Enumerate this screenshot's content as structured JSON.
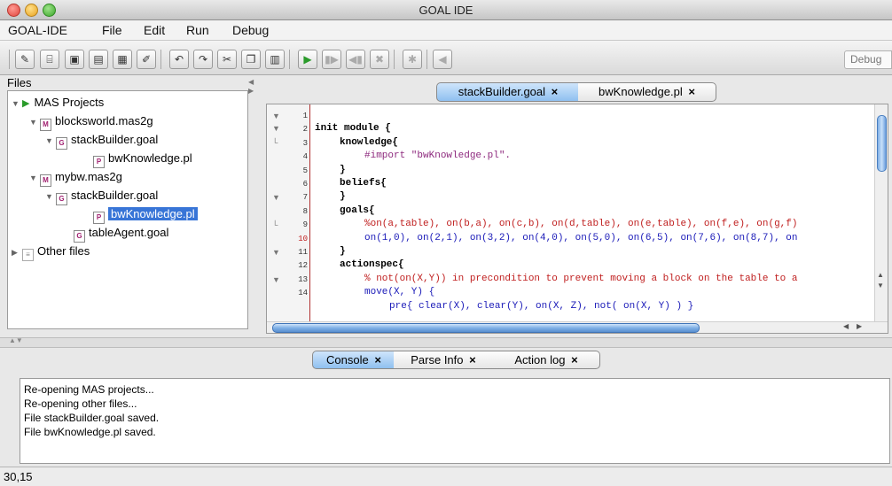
{
  "window": {
    "title": "GOAL IDE"
  },
  "menubar": {
    "items": [
      "GOAL-IDE",
      "File",
      "Edit",
      "Run",
      "Debug"
    ]
  },
  "toolbar": {
    "debug_label": "Debug"
  },
  "files": {
    "header": "Files",
    "tree": [
      {
        "label": "MAS Projects"
      },
      {
        "label": "blocksworld.mas2g"
      },
      {
        "label": "stackBuilder.goal"
      },
      {
        "label": "bwKnowledge.pl"
      },
      {
        "label": "mybw.mas2g"
      },
      {
        "label": "stackBuilder.goal"
      },
      {
        "label": "bwKnowledge.pl"
      },
      {
        "label": "tableAgent.goal"
      },
      {
        "label": "Other files"
      }
    ]
  },
  "editor": {
    "tabs": [
      {
        "label": "stackBuilder.goal",
        "close": "×"
      },
      {
        "label": "bwKnowledge.pl",
        "close": "×"
      }
    ],
    "line_numbers": [
      "1",
      "2",
      "3",
      "4",
      "5",
      "6",
      "7",
      "8",
      "9",
      "10",
      "11",
      "12",
      "13",
      "14"
    ],
    "lines": [
      "init module {",
      "knowledge{",
      "#import \"bwKnowledge.pl\".",
      "}",
      "beliefs{",
      "}",
      "goals{",
      "%on(a,table), on(b,a), on(c,b), on(d,table), on(e,table), on(f,e), on(g,f)",
      "on(1,0), on(2,1), on(3,2), on(4,0), on(5,0), on(6,5), on(7,6), on(8,7), on",
      "}",
      "actionspec{",
      "% not(on(X,Y)) in precondition to prevent moving a block on the table to a",
      "move(X, Y) {",
      "pre{ clear(X), clear(Y), on(X, Z), not( on(X, Y) ) }"
    ]
  },
  "console": {
    "tabs": [
      {
        "label": "Console",
        "close": "×"
      },
      {
        "label": "Parse Info",
        "close": "×"
      },
      {
        "label": "Action log",
        "close": "×"
      }
    ],
    "lines": [
      "Re-opening MAS projects...",
      "Re-opening other files...",
      "File stackBuilder.goal saved.",
      "File bwKnowledge.pl saved."
    ]
  },
  "status": {
    "position": "30,15"
  },
  "colors": {
    "selection": "#3875d7",
    "active_tab": "#9cc7f2",
    "close_light": "#ff5f56",
    "min_light": "#ffbd2e",
    "max_light": "#27c93f"
  }
}
